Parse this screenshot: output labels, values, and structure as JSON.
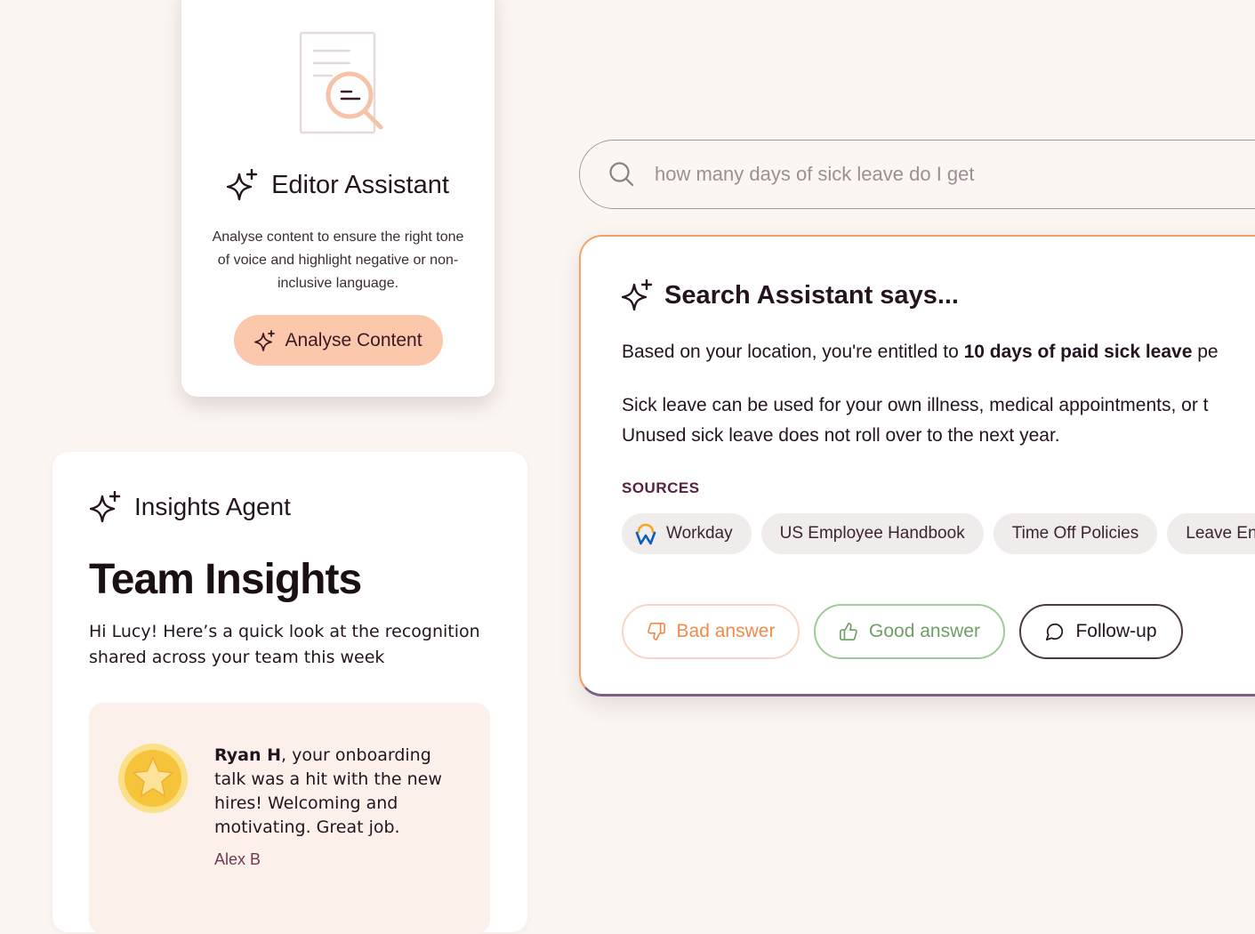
{
  "editor_assistant": {
    "title": "Editor Assistant",
    "description": "Analyse content to ensure the right tone of voice and highlight negative or non-inclusive language.",
    "analyse_button_label": "Analyse Content",
    "icons": [
      "document-magnifier-icon",
      "sparkle-icon"
    ]
  },
  "insights_agent": {
    "label": "Insights Agent",
    "title": "Team Insights",
    "intro": "Hi Lucy! Here’s a quick look at the recognition shared across your team this week",
    "recognition": {
      "name": "Ryan H",
      "message": ", your onboarding talk was a hit with the new hires! Welcoming and motivating. Great job.",
      "author": "Alex B",
      "icon": "star-medal-icon"
    }
  },
  "search": {
    "query": "how many days of sick leave do I get",
    "icon": "search-icon"
  },
  "search_assistant": {
    "title": "Search Assistant says...",
    "answer_prefix": "Based on your location, you're entitled to ",
    "answer_bold": "10 days of paid sick leave",
    "answer_suffix": " pe",
    "answer_line_2": "Sick leave can be used for your own illness, medical appointments, or t",
    "answer_line_3": "Unused sick leave does not roll over to the next year.",
    "sources_label": "SOURCES",
    "sources": [
      "Workday",
      "US Employee Handbook",
      "Time Off Policies",
      "Leave Enti"
    ],
    "bad_answer_label": "Bad answer",
    "good_answer_label": "Good answer",
    "follow_up_label": "Follow-up"
  },
  "colors": {
    "background": "#fcf6f3",
    "accent_peach": "#fbc8ac",
    "accent_orange": "#f08a4c",
    "good_green": "#6f9e67",
    "heading_plum": "#5a2040",
    "author_plum": "#6d3a55",
    "medal_gold": "#f6c43a"
  }
}
